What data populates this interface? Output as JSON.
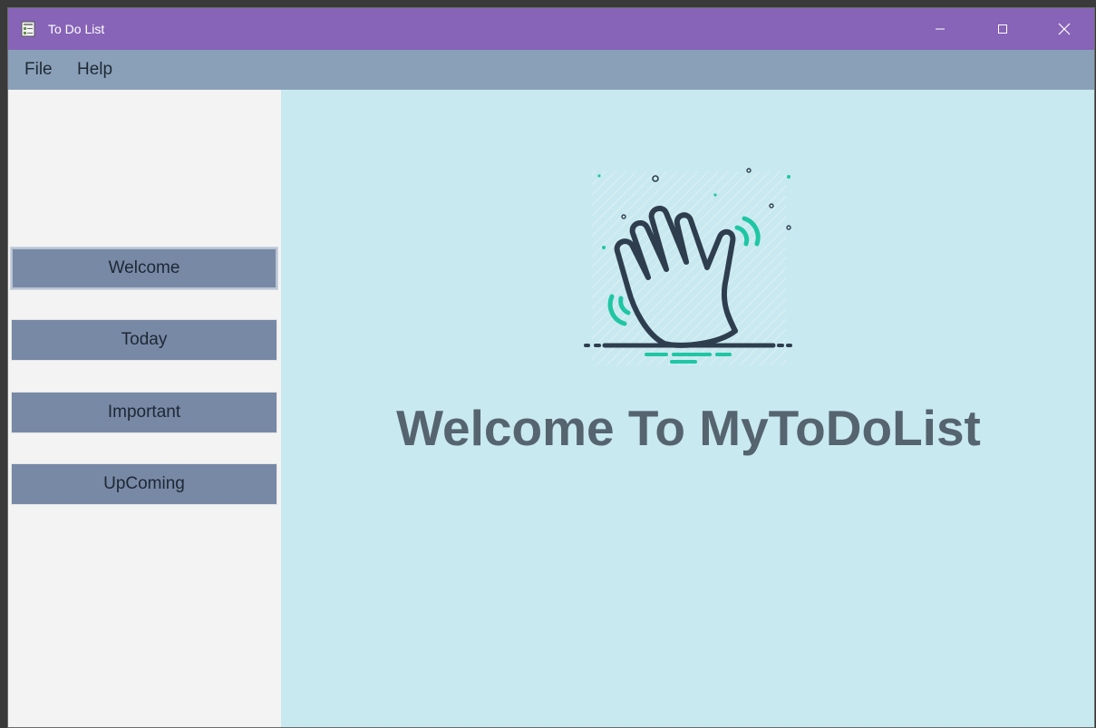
{
  "window": {
    "title": "To Do List",
    "controls": {
      "minimize_icon": "minimize-icon",
      "maximize_icon": "maximize-icon",
      "close_icon": "close-icon"
    }
  },
  "menubar": {
    "items": [
      {
        "label": "File"
      },
      {
        "label": "Help"
      }
    ]
  },
  "sidebar": {
    "items": [
      {
        "label": "Welcome",
        "active": true
      },
      {
        "label": "Today",
        "active": false
      },
      {
        "label": "Important",
        "active": false
      },
      {
        "label": "UpComing",
        "active": false
      }
    ]
  },
  "main": {
    "illustration": "waving-hand-icon",
    "heading": "Welcome To MyToDoList"
  },
  "colors": {
    "titlebar": "#8764b8",
    "menubar": "#8aa0b8",
    "nav_button": "#7889a6",
    "content_bg": "#c8e9ef",
    "heading": "#55646f",
    "accent": "#1fc6a4"
  }
}
